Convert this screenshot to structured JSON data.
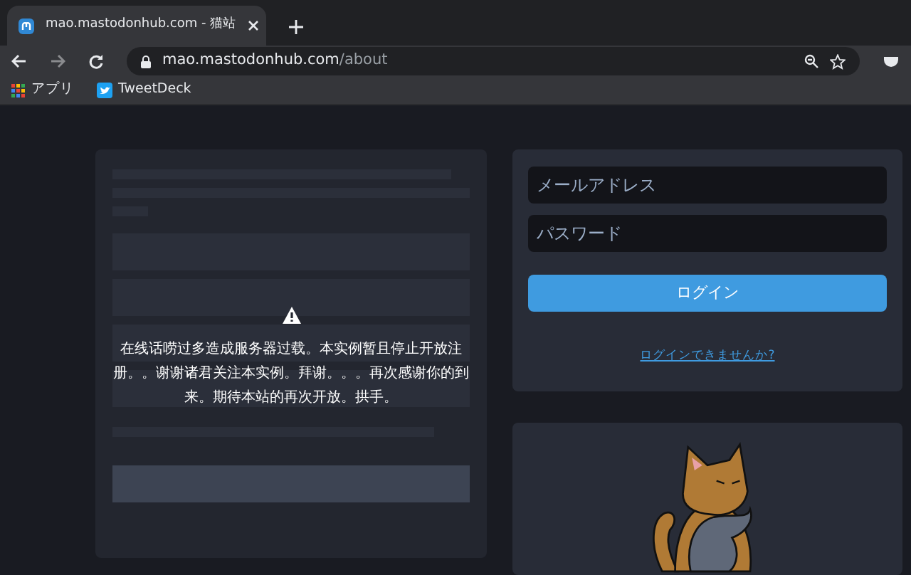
{
  "browser": {
    "tab": {
      "title": "mao.mastodonhub.com - 猫站"
    },
    "address": {
      "host": "mao.mastodonhub.com",
      "path": "/about"
    },
    "bookmarks": [
      {
        "label": "アプリ",
        "kind": "apps"
      },
      {
        "label": "TweetDeck",
        "kind": "bird"
      }
    ]
  },
  "notice": {
    "message": "在线话唠过多造成服务器过载。本实例暂且停止开放注册。。谢谢诸君关注本实例。拜谢。。。再次感谢你的到来。期待本站的再次开放。拱手。"
  },
  "login": {
    "fields": [
      {
        "placeholder": "メールアドレス"
      },
      {
        "placeholder": "パスワード"
      }
    ],
    "button": "ログイン",
    "link": "ログインできませんか?"
  }
}
